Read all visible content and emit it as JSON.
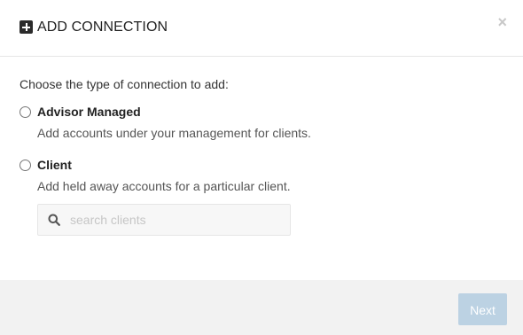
{
  "header": {
    "icon": "plus-square-icon",
    "title": "ADD CONNECTION",
    "close_label": "×"
  },
  "body": {
    "prompt": "Choose the type of connection to add:",
    "options": [
      {
        "label": "Advisor Managed",
        "description": "Add accounts under your management for clients.",
        "selected": false
      },
      {
        "label": "Client",
        "description": "Add held away accounts for a particular client.",
        "selected": false
      }
    ],
    "search": {
      "icon": "search-icon",
      "placeholder": "search clients",
      "value": ""
    }
  },
  "footer": {
    "next_label": "Next",
    "next_enabled": false
  },
  "colors": {
    "next_button_bg": "#bcd2e3",
    "footer_bg": "#f2f2f2",
    "title": "#222222"
  }
}
